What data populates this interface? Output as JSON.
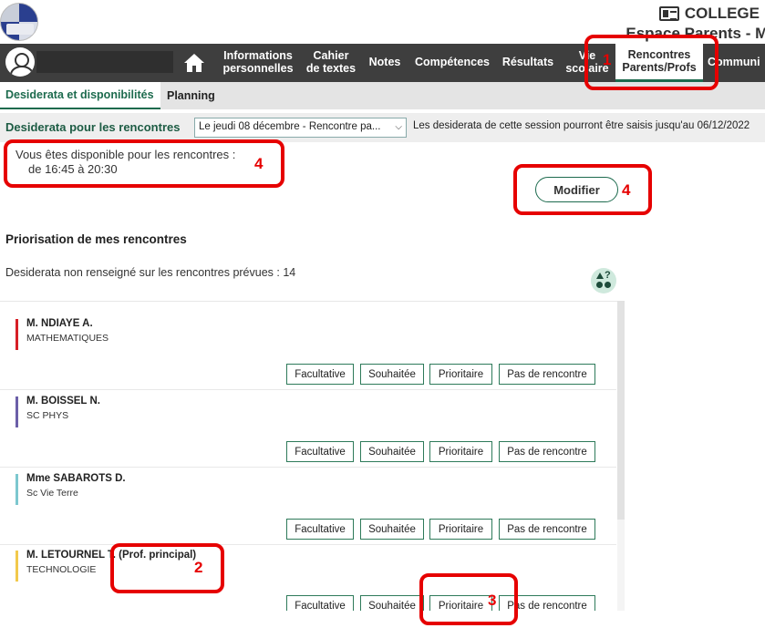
{
  "header": {
    "school_name": "COLLEGE",
    "espace_label": "Espace Parents - M."
  },
  "nav": {
    "items": [
      {
        "label": "Informations\npersonnelles"
      },
      {
        "label": "Cahier\nde textes"
      },
      {
        "label": "Notes"
      },
      {
        "label": "Compétences"
      },
      {
        "label": "Résultats"
      },
      {
        "label": "Vie\nscolaire"
      },
      {
        "label": "Rencontres\nParents/Profs"
      },
      {
        "label": "Communi"
      }
    ]
  },
  "subtabs": {
    "desiderata": "Desiderata et disponibilités",
    "planning": "Planning"
  },
  "session": {
    "label": "Desiderata pour les rencontres",
    "selected": "Le jeudi 08 décembre - Rencontre pa...",
    "info": "Les desiderata de cette session pourront être saisis jusqu'au 06/12/2022"
  },
  "availability": {
    "line1": "Vous êtes disponible pour les rencontres :",
    "line2": "de 16:45 à 20:30",
    "modify_label": "Modifier"
  },
  "priorisation": {
    "title": "Priorisation de mes rencontres",
    "non_renseigne": "Desiderata non renseigné sur les rencontres prévues : 14"
  },
  "buttons": {
    "facultative": "Facultative",
    "souhaitee": "Souhaitée",
    "prioritaire": "Prioritaire",
    "pas_de_rencontre": "Pas de rencontre"
  },
  "teachers": [
    {
      "name": "M. NDIAYE A.",
      "subject": "MATHEMATIQUES",
      "color": "#d61f26"
    },
    {
      "name": "M. BOISSEL N.",
      "subject": "SC PHYS",
      "color": "#6b5fa8"
    },
    {
      "name": "Mme SABAROTS D.",
      "subject": "Sc Vie Terre",
      "color": "#7cc7cf"
    },
    {
      "name": "M. LETOURNEL T. (Prof. principal)",
      "subject": "TECHNOLOGIE",
      "color": "#f2c94c"
    }
  ],
  "annotations": {
    "n1": "1",
    "n2": "2",
    "n3": "3",
    "n4a": "4",
    "n4b": "4"
  },
  "colors": {
    "accent": "#1d6b4e",
    "navbar": "#3e3e3e",
    "annotation": "#e60000"
  }
}
